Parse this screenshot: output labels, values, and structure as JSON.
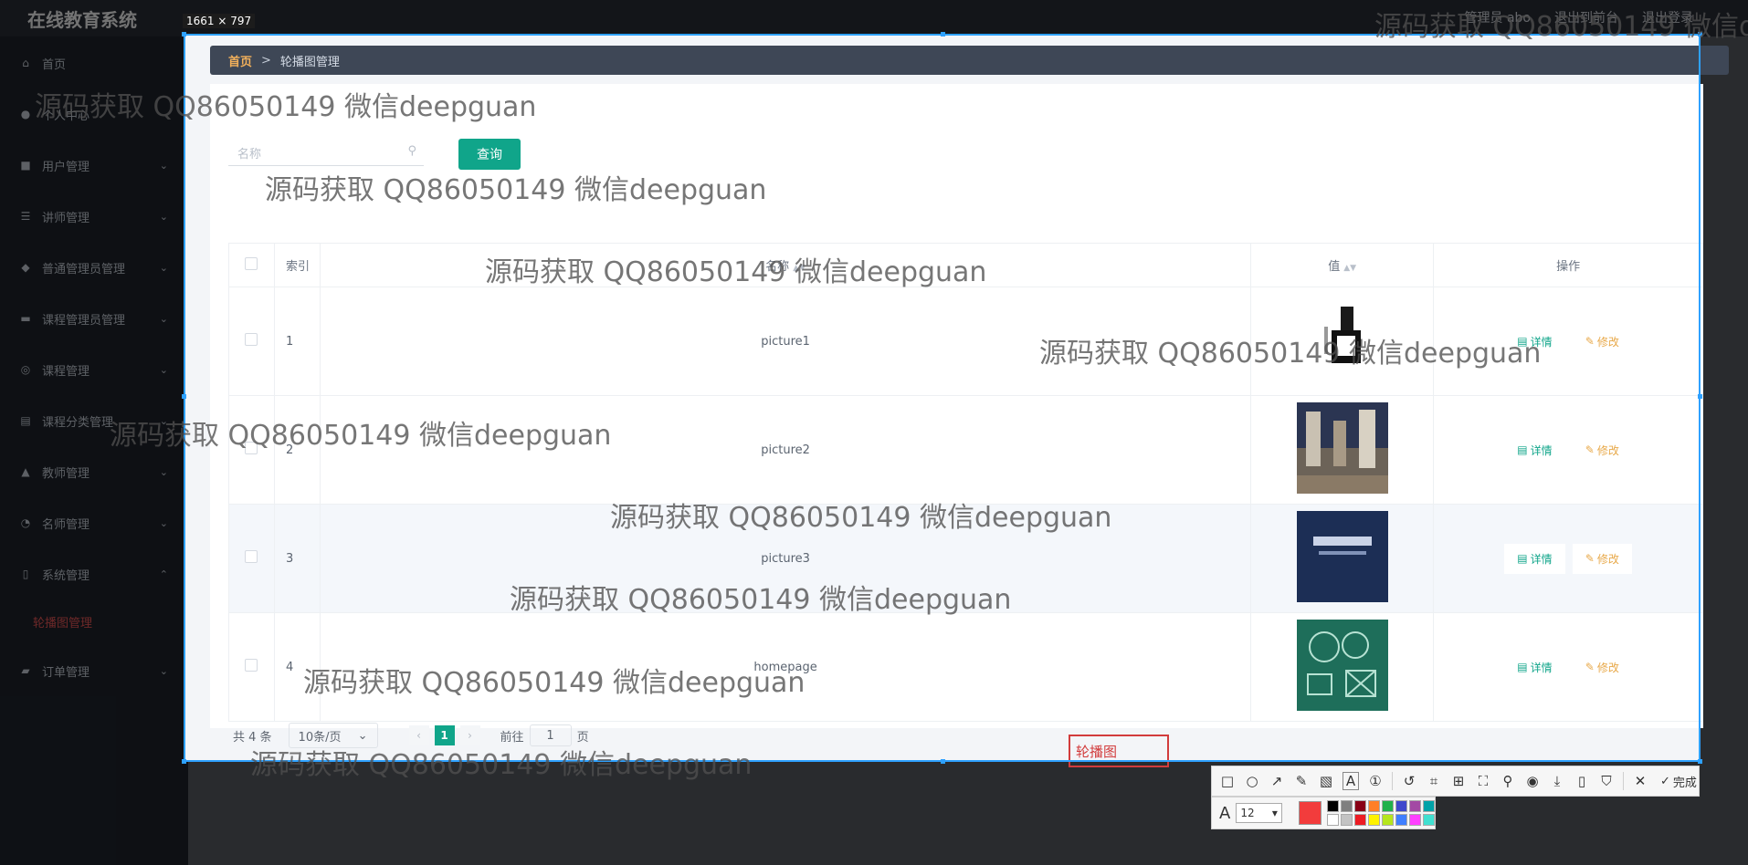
{
  "app": {
    "title": "在线教育系统",
    "user_label": "管理员 abo",
    "back_home": "退出到前台",
    "logout": "退出登录"
  },
  "sidebar": {
    "items": [
      {
        "label": "首页",
        "icon": "home-icon"
      },
      {
        "label": "个人中心",
        "icon": "user-icon"
      },
      {
        "label": "用户管理",
        "icon": "chat-icon"
      },
      {
        "label": "讲师管理",
        "icon": "list-icon"
      },
      {
        "label": "普通管理员管理",
        "icon": "pin-icon"
      },
      {
        "label": "课程管理员管理",
        "icon": "briefcase-icon"
      },
      {
        "label": "课程管理",
        "icon": "globe-icon"
      },
      {
        "label": "课程分类管理",
        "icon": "ticket-icon"
      },
      {
        "label": "教师管理",
        "icon": "thumb-icon"
      },
      {
        "label": "名师管理",
        "icon": "gauge-icon"
      },
      {
        "label": "系统管理",
        "icon": "phone-icon"
      },
      {
        "label": "订单管理",
        "icon": "card-icon"
      }
    ],
    "active_sub": "轮播图管理"
  },
  "capture": {
    "size_label": "1661 × 797"
  },
  "breadcrumb": {
    "home": "首页",
    "separator": ">",
    "current": "轮播图管理"
  },
  "search": {
    "placeholder": "名称",
    "button": "查询"
  },
  "table": {
    "headers": [
      "索引",
      "名称",
      "值",
      "操作"
    ],
    "detail_label": "详情",
    "edit_label": "修改",
    "rows": [
      {
        "index": "1",
        "name": "picture1"
      },
      {
        "index": "2",
        "name": "picture2"
      },
      {
        "index": "3",
        "name": "picture3"
      },
      {
        "index": "4",
        "name": "homepage"
      }
    ]
  },
  "pager": {
    "total": "共 4 条",
    "page_size": "10条/页",
    "current_page": "1",
    "goto_prefix": "前往",
    "goto_value": "1",
    "goto_suffix": "页"
  },
  "annotation": {
    "text": "轮播图"
  },
  "toolbar": {
    "done": "完成",
    "font_size": "12"
  },
  "watermark": "源码获取 QQ86050149 微信deepguan",
  "watermark_top_right": "源码获取 QQ86050149 微信d",
  "colors": {
    "accent": "#10a58a",
    "edit": "#e8a94a",
    "sidebar_bg": "#1f252e",
    "breadcrumb_bg": "#3e4756",
    "selection": "#2ea1ff",
    "annotation": "#d23c3c"
  }
}
